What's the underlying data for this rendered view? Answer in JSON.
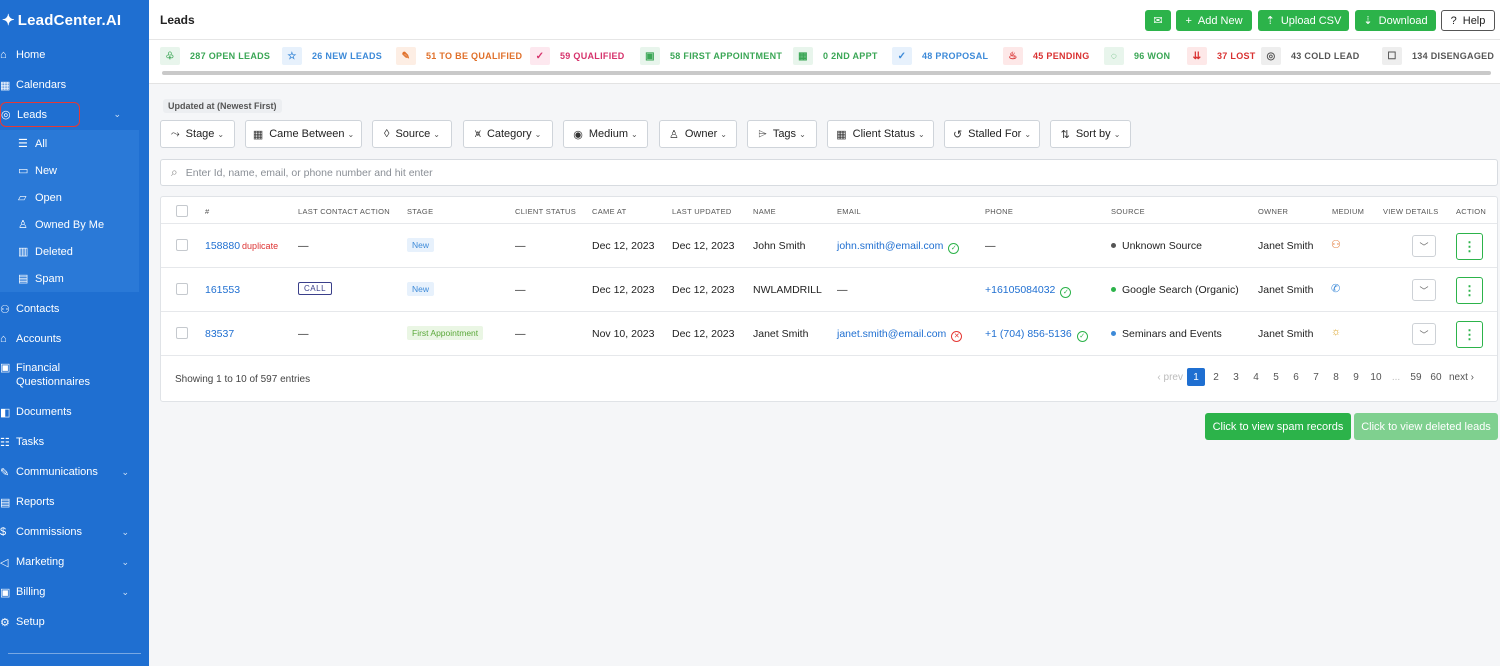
{
  "app": {
    "logo_text": "LeadCenter.AI",
    "logo_icon": "shield-icon"
  },
  "sidebar": {
    "items": [
      {
        "label": "Home",
        "icon": "home-icon"
      },
      {
        "label": "Calendars",
        "icon": "calendar-icon"
      },
      {
        "label": "Leads",
        "icon": "leads-icon",
        "active": true
      },
      {
        "label": "Contacts",
        "icon": "contacts-icon"
      },
      {
        "label": "Accounts",
        "icon": "accounts-icon"
      },
      {
        "label": "Financial Questionnaires",
        "label_line1": "Financial",
        "label_line2": "Questionnaires",
        "icon": "questionnaire-icon"
      },
      {
        "label": "Documents",
        "icon": "documents-icon"
      },
      {
        "label": "Tasks",
        "icon": "tasks-icon"
      },
      {
        "label": "Communications",
        "icon": "communications-icon"
      },
      {
        "label": "Reports",
        "icon": "reports-icon"
      },
      {
        "label": "Commissions",
        "icon": "commissions-icon"
      },
      {
        "label": "Marketing",
        "icon": "marketing-icon"
      },
      {
        "label": "Billing",
        "icon": "billing-icon"
      },
      {
        "label": "Setup",
        "icon": "setup-icon"
      }
    ],
    "sub_items": [
      {
        "label": "All",
        "icon": "list-icon"
      },
      {
        "label": "New",
        "icon": "folder-plus-icon"
      },
      {
        "label": "Open",
        "icon": "folder-open-icon"
      },
      {
        "label": "Owned By Me",
        "icon": "user-icon"
      },
      {
        "label": "Deleted",
        "icon": "trash-icon"
      },
      {
        "label": "Spam",
        "icon": "spam-icon"
      }
    ]
  },
  "header": {
    "title": "Leads",
    "add_new": "Add New",
    "upload_csv": "Upload CSV",
    "download": "Download",
    "help": "Help"
  },
  "status_strip": [
    {
      "label": "287 OPEN LEADS",
      "color": "#3aa655",
      "bg": "#e8f5ec"
    },
    {
      "label": "26 NEW LEADS",
      "color": "#3d8ad8",
      "bg": "#e7f1fc"
    },
    {
      "label": "51 TO BE QUALIFIED",
      "color": "#e0702a",
      "bg": "#fdeee4"
    },
    {
      "label": "59 QUALIFIED",
      "color": "#d6336c",
      "bg": "#fde8ef"
    },
    {
      "label": "58 FIRST APPOINTMENT",
      "color": "#3aa655",
      "bg": "#e8f5ec"
    },
    {
      "label": "0 2ND APPT",
      "color": "#3aa655",
      "bg": "#e8f5ec"
    },
    {
      "label": "48 PROPOSAL",
      "color": "#3d8ad8",
      "bg": "#e7f1fc"
    },
    {
      "label": "45 PENDING",
      "color": "#d93232",
      "bg": "#fde8e8"
    },
    {
      "label": "96 WON",
      "color": "#3aa655",
      "bg": "#e8f5ec"
    },
    {
      "label": "37 LOST",
      "color": "#d93232",
      "bg": "#fde8e8"
    },
    {
      "label": "43 COLD LEAD",
      "color": "#555555",
      "bg": "#eeeeee"
    },
    {
      "label": "134 DISENGAGED",
      "color": "#555555",
      "bg": "#eeeeee"
    }
  ],
  "sort_chip": "Updated at (Newest First)",
  "filters": [
    "Stage",
    "Came Between",
    "Source",
    "Category",
    "Medium",
    "Owner",
    "Tags",
    "Client Status",
    "Stalled For",
    "Sort by"
  ],
  "search": {
    "placeholder": "Enter Id, name, email, or phone number and hit enter"
  },
  "table": {
    "headers": [
      "#",
      "LAST CONTACT ACTION",
      "STAGE",
      "CLIENT STATUS",
      "CAME AT",
      "LAST UPDATED",
      "NAME",
      "EMAIL",
      "PHONE",
      "SOURCE",
      "OWNER",
      "MEDIUM",
      "VIEW DETAILS",
      "ACTION"
    ],
    "rows": [
      {
        "id": "158880",
        "dup": "duplicate",
        "last_action": "—",
        "stage": "New",
        "client_status": "—",
        "came_at": "Dec 12, 2023",
        "last_updated": "Dec 12, 2023",
        "name": "John Smith",
        "email": "john.smith@email.com",
        "email_status": "valid",
        "phone": "—",
        "source": "Unknown Source",
        "source_color": "#555555",
        "owner": "Janet Smith",
        "medium": "people-icon"
      },
      {
        "id": "161553",
        "dup": "",
        "last_action": "CALL",
        "stage": "New",
        "client_status": "—",
        "came_at": "Dec 12, 2023",
        "last_updated": "Dec 12, 2023",
        "name": "NWLAMDRILL",
        "email": "—",
        "email_status": "",
        "phone": "+16105084032",
        "source": "Google Search (Organic)",
        "source_color": "#2cb34a",
        "owner": "Janet Smith",
        "medium": "phone-icon"
      },
      {
        "id": "83537",
        "dup": "",
        "last_action": "—",
        "stage": "First Appointment",
        "client_status": "—",
        "came_at": "Nov 10, 2023",
        "last_updated": "Dec 12, 2023",
        "name": "Janet Smith",
        "email": "janet.smith@email.com",
        "email_status": "invalid",
        "phone": "+1 (704) 856-5136",
        "source": "Seminars and Events",
        "source_color": "#3d8ad8",
        "owner": "Janet Smith",
        "medium": "sun-icon"
      }
    ],
    "showing": "Showing 1 to 10 of 597 entries"
  },
  "pagination": {
    "prev": "prev",
    "pages": [
      "1",
      "2",
      "3",
      "4",
      "5",
      "6",
      "7",
      "8",
      "9",
      "10"
    ],
    "ellipsis": "...",
    "tail": [
      "59",
      "60"
    ],
    "next": "next",
    "current": "1"
  },
  "bottom_buttons": {
    "spam": "Click to view spam records",
    "deleted": "Click to view deleted leads"
  }
}
